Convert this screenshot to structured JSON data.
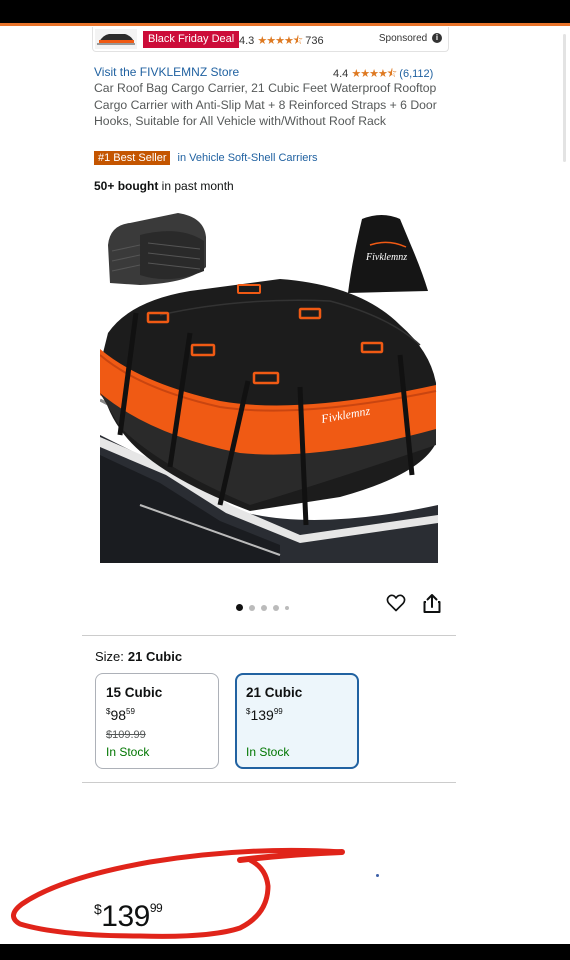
{
  "ad": {
    "deal_badge": "Black Friday Deal",
    "rating_value": "4.3",
    "rating_stars": "★★★★⯪",
    "rating_count": "736",
    "sponsored_label": "Sponsored",
    "info_glyph": "i"
  },
  "product": {
    "store_link": "Visit the FIVKLEMNZ Store",
    "rating_value": "4.4",
    "rating_stars": "★★★★⯪",
    "rating_count": "(6,112)",
    "title": "Car Roof Bag Cargo Carrier, 21 Cubic Feet Waterproof Rooftop Cargo Carrier with Anti-Slip Mat + 8 Reinforced Straps + 6 Door Hooks, Suitable for All Vehicle with/Without Roof Rack",
    "bestseller_badge": "#1 Best Seller",
    "bestseller_category": "in Vehicle Soft-Shell Carriers",
    "bought_bold": "50+ bought",
    "bought_rest": " in past month",
    "brand_on_bag": "Fivklemnz",
    "image_count": 5,
    "active_image_index": 0
  },
  "size": {
    "label": "Size:",
    "selected": "21 Cubic",
    "options": [
      {
        "name": "15 Cubic",
        "currency": "$",
        "price_whole": "98",
        "price_fraction": "59",
        "list_price": "$109.99",
        "stock": "In Stock",
        "selected": false
      },
      {
        "name": "21 Cubic",
        "currency": "$",
        "price_whole": "139",
        "price_fraction": "99",
        "list_price": "",
        "stock": "In Stock",
        "selected": true
      }
    ]
  },
  "price": {
    "currency": "$",
    "whole": "139",
    "fraction": "99"
  },
  "colors": {
    "deal_red": "#cc0c39",
    "link_blue": "#2162a1",
    "star_orange": "#de7921",
    "bestseller_orange": "#c45500",
    "in_stock_green": "#007600",
    "annotation_red": "#e0241a",
    "bag_orange": "#f05a14"
  },
  "icons": [
    "info-icon",
    "heart-icon",
    "share-icon"
  ]
}
